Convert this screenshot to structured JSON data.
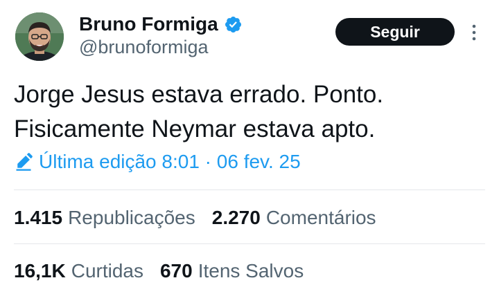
{
  "author": {
    "display_name": "Bruno Formiga",
    "handle": "@brunoformiga",
    "verified": true
  },
  "actions": {
    "follow_label": "Seguir"
  },
  "tweet": {
    "lines": [
      "Jorge Jesus estava errado. Ponto.",
      "Fisicamente Neymar estava apto."
    ],
    "edit_info": "Última edição 8:01 · 06 fev. 25"
  },
  "stats": {
    "reposts": {
      "count": "1.415",
      "label": "Republicações"
    },
    "comments": {
      "count": "2.270",
      "label": "Comentários"
    },
    "likes": {
      "count": "16,1K",
      "label": "Curtidas"
    },
    "bookmarks": {
      "count": "670",
      "label": "Itens Salvos"
    }
  },
  "colors": {
    "accent": "#1d9bf0",
    "text_primary": "#0f1419",
    "text_secondary": "#536471",
    "button_bg": "#0f1419"
  },
  "icons": {
    "verified": "verified-badge-icon",
    "more": "more-vertical-icon",
    "edit": "pencil-icon"
  }
}
